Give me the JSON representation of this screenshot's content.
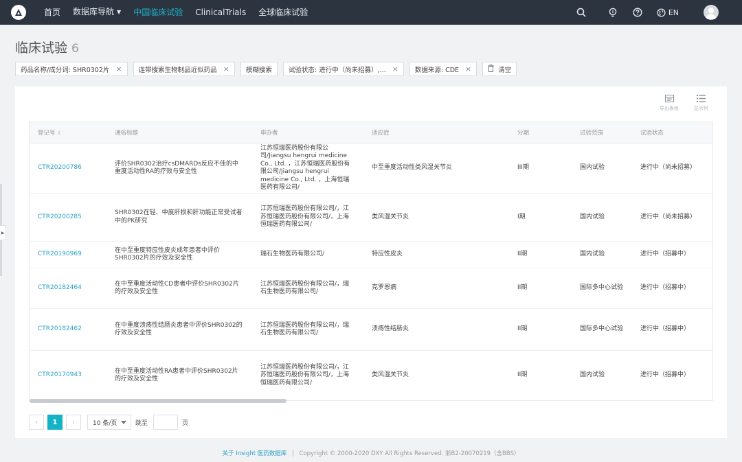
{
  "nav": {
    "links": [
      "首页",
      "数据库导航",
      "中国临床试验",
      "ClinicalTrials",
      "全球临床试验"
    ],
    "active_index": 2,
    "lang": "EN"
  },
  "page": {
    "title": "临床试验",
    "count": "6"
  },
  "filters": [
    "药品名称/成分词: SHR0302片",
    "连带搜索生物制品近似药品",
    "模糊搜索",
    "试验状态: 进行中（尚未招募）,...",
    "数据来源: CDE",
    "清空"
  ],
  "tools": {
    "export": "导出表格",
    "display": "显示列"
  },
  "table": {
    "headers": [
      "登记号",
      "通俗标题",
      "申办者",
      "适应症",
      "分期",
      "试验范围",
      "试验状态"
    ],
    "rows": [
      {
        "id": "CTR20200786",
        "title": "评价SHR0302治疗csDMARDs反应不佳的中重度活动性RA的疗效与安全性",
        "sponsor": "江苏恒瑞医药股份有限公司/Jiangsu hengrui medicine Co., Ltd. ，江苏恒瑞医药股份有限公司/Jiangsu hengrui medicine Co., Ltd. ，上海恒瑞医药有限公司/",
        "indication": "中至重度活动性类风湿关节炎",
        "phase": "III期",
        "scope": "国内试验",
        "status": "进行中（尚未招募）"
      },
      {
        "id": "CTR20200285",
        "title": "SHR0302在轻、中度肝损和肝功能正常受试者中的PK研究",
        "sponsor": "江苏恒瑞医药股份有限公司/，江苏恒瑞医药股份有限公司/，上海恒瑞医药有限公司/",
        "indication": "类风湿关节炎",
        "phase": "I期",
        "scope": "国内试验",
        "status": "进行中（尚未招募）"
      },
      {
        "id": "CTR20190969",
        "title": "在中至重度特应性皮炎成年患者中评价SHR0302片的疗效及安全性",
        "sponsor": "瑞石生物医药有限公司/",
        "indication": "特应性皮炎",
        "phase": "II期",
        "scope": "国内试验",
        "status": "进行中（招募中）"
      },
      {
        "id": "CTR20182464",
        "title": "在中至重度活动性CD患者中评价SHR0302片的疗效及安全性",
        "sponsor": "江苏恒瑞医药股份有限公司/，瑞石生物医药有限公司/",
        "indication": "克罗恩病",
        "phase": "II期",
        "scope": "国际多中心试验",
        "status": "进行中（招募中）"
      },
      {
        "id": "CTR20182462",
        "title": "在中重度溃疡性结肠炎患者中评价SHR0302的疗效及安全性",
        "sponsor": "江苏恒瑞医药股份有限公司/，瑞石生物医药有限公司/",
        "indication": "溃疡性结肠炎",
        "phase": "II期",
        "scope": "国际多中心试验",
        "status": "进行中（招募中）"
      },
      {
        "id": "CTR20170943",
        "title": "在中至重度活动性RA患者中评价SHR0302片的疗效及安全性",
        "sponsor": "江苏恒瑞医药股份有限公司/，江苏恒瑞医药股份有限公司/，上海恒瑞医药有限公司/",
        "indication": "类风湿关节炎",
        "phase": "II期",
        "scope": "国内试验",
        "status": "进行中（招募中）"
      }
    ]
  },
  "pagination": {
    "prev": "‹",
    "current": "1",
    "next": "›",
    "page_size": "10 条/页",
    "jump_label": "跳至",
    "page_unit": "页"
  },
  "footer": {
    "link": "关于 Insight 医药数据库",
    "separator": "|",
    "copyright": "Copyright © 2000-2020 DXY All Rights Reserved. 浙B2-20070219（含BBS）"
  },
  "colors": {
    "nav_bg": "#2c3440",
    "accent": "#14b2c7",
    "link": "#2aa1c4"
  }
}
